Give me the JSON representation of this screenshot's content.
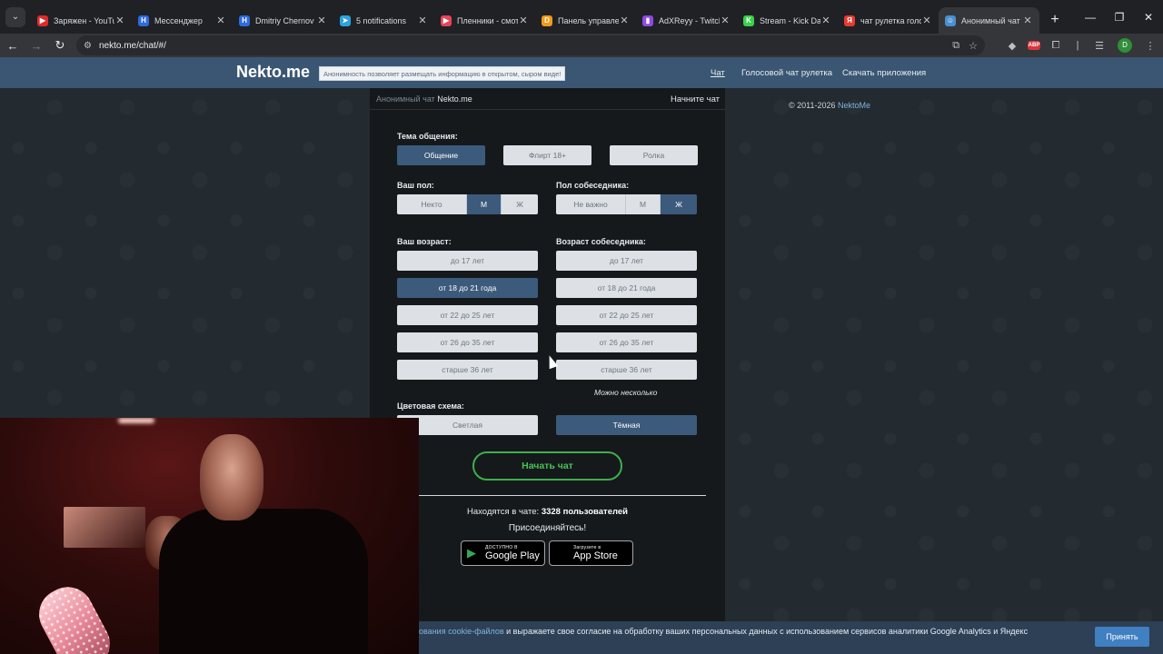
{
  "browser": {
    "tabs": [
      {
        "title": "Заряжен - YouTube",
        "icon": "youtube-icon",
        "color": "#e02a2a",
        "glyph": "▶",
        "active": false
      },
      {
        "title": "Мессенджер",
        "icon": "messenger-icon",
        "color": "#2d6cdf",
        "glyph": "H",
        "active": false
      },
      {
        "title": "Dmitriy Chernov",
        "icon": "messenger-icon",
        "color": "#2d6cdf",
        "glyph": "H",
        "active": false
      },
      {
        "title": "5 notifications",
        "icon": "telegram-icon",
        "color": "#2aa3de",
        "glyph": "➤",
        "active": false
      },
      {
        "title": "Пленники - смотреть",
        "icon": "kinopoisk-icon",
        "color": "#e8455a",
        "glyph": "▶",
        "active": false
      },
      {
        "title": "Панель управления",
        "icon": "donationalerts-icon",
        "color": "#f29a1a",
        "glyph": "D",
        "active": false
      },
      {
        "title": "AdXReyy - Twitch",
        "icon": "twitch-icon",
        "color": "#8e4ae6",
        "glyph": "▮",
        "active": false
      },
      {
        "title": "Stream - Kick Dashboard",
        "icon": "kick-icon",
        "color": "#3ad14a",
        "glyph": "K",
        "active": false
      },
      {
        "title": "чат рулетка голосовой",
        "icon": "yandex-icon",
        "color": "#e73b2f",
        "glyph": "Я",
        "active": false
      },
      {
        "title": "Анонимный чат Nekto.me",
        "icon": "nekto-icon",
        "color": "#4a8fd1",
        "glyph": "☺",
        "active": true
      }
    ],
    "url": "nekto.me/chat/#/"
  },
  "header": {
    "logo": "Nekto.me",
    "slogan": "Анонимность позволяет размещать информацию в открытом, сыром виде!",
    "nav": [
      "Чат",
      "Голосовой чат рулетка",
      "Скачать приложения"
    ]
  },
  "copyright": {
    "text": "© 2011-2026 ",
    "link": "NektoMe"
  },
  "panel": {
    "crumb_prefix": "Анонимный чат",
    "crumb_site": "Nekto.me",
    "start_link": "Начните чат",
    "topic": {
      "label": "Тема общения:",
      "options": [
        "Общение",
        "Флирт 18+",
        "Ролка"
      ],
      "selected": "Общение"
    },
    "my_gender": {
      "label": "Ваш пол:",
      "options": [
        "Некто",
        "М",
        "Ж"
      ],
      "selected": "М"
    },
    "partner_gender": {
      "label": "Пол собеседника:",
      "options": [
        "Не важно",
        "М",
        "Ж"
      ],
      "selected": "Ж"
    },
    "my_age": {
      "label": "Ваш возраст:",
      "options": [
        "до 17 лет",
        "от 18 до 21 года",
        "от 22 до 25 лет",
        "от 26 до 35 лет",
        "старше 36 лет"
      ],
      "selected": "от 18 до 21 года"
    },
    "partner_age": {
      "label": "Возраст собеседника:",
      "options": [
        "до 17 лет",
        "от 18 до 21 года",
        "от 22 до 25 лет",
        "от 26 до 35 лет",
        "старше 36 лет"
      ],
      "hint": "Можно несколько"
    },
    "theme": {
      "label": "Цветовая схема:",
      "options": [
        "Светлая",
        "Тёмная"
      ],
      "selected": "Тёмная"
    },
    "start_button": "Начать чат",
    "online_prefix": "Находятся в чате:",
    "online_count": "3328 пользователей",
    "join": "Присоединяйтесь!",
    "stores": [
      {
        "small": "ДОСТУПНО В",
        "name": "Google Play",
        "icon": "google-play-icon"
      },
      {
        "small": "Загрузите в",
        "name": "App Store",
        "icon": "apple-icon"
      }
    ]
  },
  "cookie": {
    "text_link": "ования cookie-файлов",
    "text_rest": " и выражаете свое согласие на обработку ваших персональных данных с использованием сервисов аналитики Google Analytics и Яндекс",
    "accept": "Принять"
  }
}
